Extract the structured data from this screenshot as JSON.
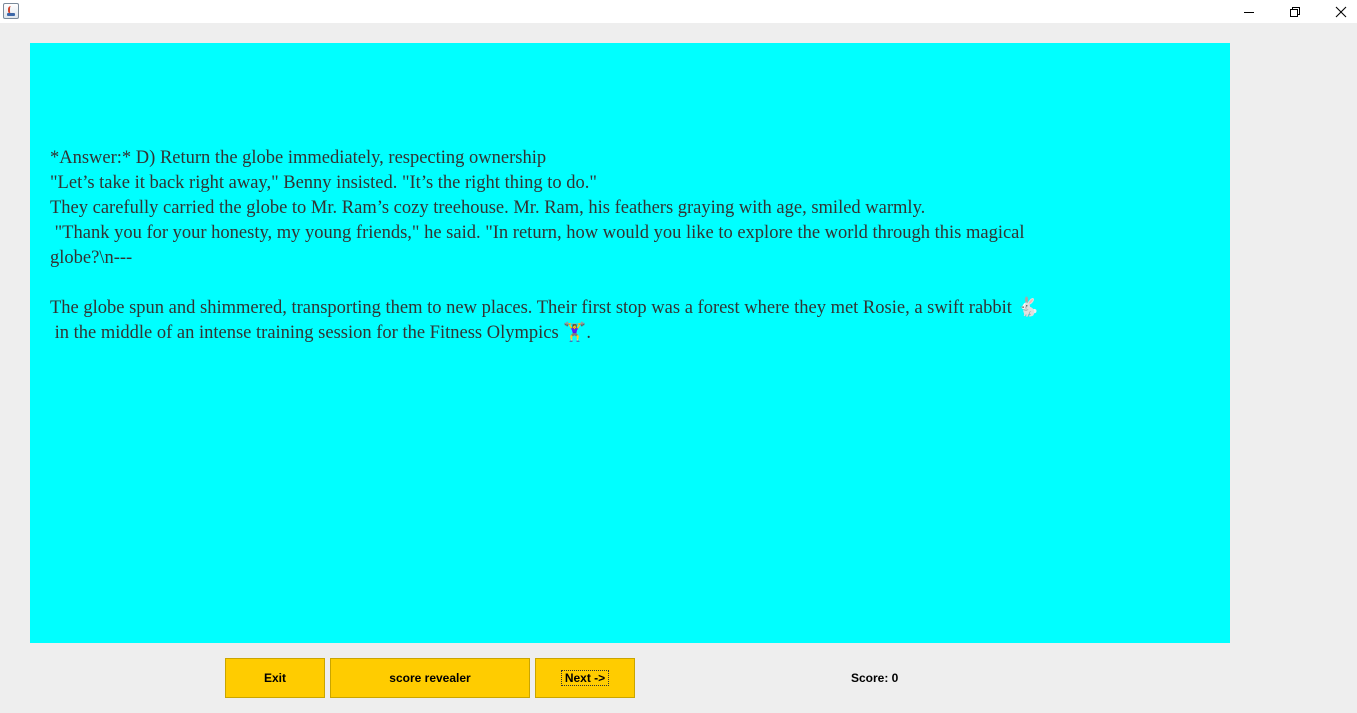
{
  "window": {
    "icon": "java-cup-icon",
    "controls": [
      "minimize-icon",
      "restore-icon",
      "close-icon"
    ]
  },
  "story": {
    "text": "*Answer:* D) Return the globe immediately, respecting ownership\n\"Let’s take it back right away,\" Benny insisted. \"It’s the right thing to do.\"\nThey carefully carried the globe to Mr. Ram’s cozy treehouse. Mr. Ram, his feathers graying with age, smiled warmly.\n \"Thank you for your honesty, my young friends,\" he said. \"In return, how would you like to explore the world through this magical globe?\\n---\n\nThe globe spun and shimmered, transporting them to new places. Their first stop was a forest where they met Rosie, a swift rabbit 🐇\n in the middle of an intense training session for the Fitness Olympics 🏋️‍♀️.",
    "background_color": "#00ffff"
  },
  "buttons": {
    "exit_label": "Exit",
    "score_revealer_label": "score revealer",
    "next_label": "Next ->",
    "color": "#ffcc00"
  },
  "score": {
    "label": "Score: 0"
  }
}
